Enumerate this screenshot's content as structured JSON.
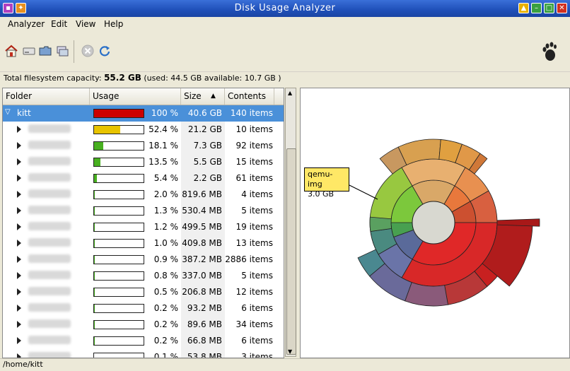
{
  "window": {
    "title": "Disk Usage Analyzer"
  },
  "menu": {
    "analyzer": "Analyzer",
    "edit": "Edit",
    "view": "View",
    "help": "Help"
  },
  "toolbar": {
    "icons": [
      "home-icon",
      "drive-icon",
      "folder-icon",
      "remote-folder-icon",
      "stop-icon",
      "refresh-icon"
    ],
    "logo_icon": "gnome-foot-icon"
  },
  "capacity": {
    "prefix": "Total filesystem capacity:",
    "total": "55.2 GB",
    "detail": "(used: 44.5 GB available: 10.7 GB )"
  },
  "columns": {
    "folder": "Folder",
    "usage": "Usage",
    "size": "Size",
    "contents": "Contents"
  },
  "root": {
    "name": "kitt",
    "percent": "100 %",
    "size": "40.6 GB",
    "items": "140 items",
    "fill": 1.0,
    "color": "#cc0000"
  },
  "rows": [
    {
      "percent": "52.4 %",
      "size": "21.2 GB",
      "items": "10 items",
      "fill": 0.524,
      "color": "#e8c400"
    },
    {
      "percent": "18.1 %",
      "size": "7.3 GB",
      "items": "92 items",
      "fill": 0.181,
      "color": "#48b020"
    },
    {
      "percent": "13.5 %",
      "size": "5.5 GB",
      "items": "15 items",
      "fill": 0.135,
      "color": "#48b020"
    },
    {
      "percent": "5.4 %",
      "size": "2.2 GB",
      "items": "61 items",
      "fill": 0.054,
      "color": "#48b020"
    },
    {
      "percent": "2.0 %",
      "size": "819.6 MB",
      "items": "4 items",
      "fill": 0.02,
      "color": "#48b020"
    },
    {
      "percent": "1.3 %",
      "size": "530.4 MB",
      "items": "5 items",
      "fill": 0.013,
      "color": "#48b020"
    },
    {
      "percent": "1.2 %",
      "size": "499.5 MB",
      "items": "19 items",
      "fill": 0.012,
      "color": "#48b020"
    },
    {
      "percent": "1.0 %",
      "size": "409.8 MB",
      "items": "13 items",
      "fill": 0.01,
      "color": "#48b020"
    },
    {
      "percent": "0.9 %",
      "size": "387.2 MB",
      "items": "2886 items",
      "fill": 0.009,
      "color": "#48b020"
    },
    {
      "percent": "0.8 %",
      "size": "337.0 MB",
      "items": "5 items",
      "fill": 0.008,
      "color": "#48b020"
    },
    {
      "percent": "0.5 %",
      "size": "206.8 MB",
      "items": "12 items",
      "fill": 0.005,
      "color": "#48b020"
    },
    {
      "percent": "0.2 %",
      "size": "93.2 MB",
      "items": "6 items",
      "fill": 0.002,
      "color": "#48b020"
    },
    {
      "percent": "0.2 %",
      "size": "89.6 MB",
      "items": "34 items",
      "fill": 0.002,
      "color": "#48b020"
    },
    {
      "percent": "0.2 %",
      "size": "66.8 MB",
      "items": "6 items",
      "fill": 0.002,
      "color": "#48b020"
    },
    {
      "percent": "0.1 %",
      "size": "53.8 MB",
      "items": "3 items",
      "fill": 0.001,
      "color": "#48b020"
    }
  ],
  "tooltip": {
    "name": "qemu-img",
    "size": "3.0 GB"
  },
  "status": {
    "path": "/home/kitt"
  }
}
